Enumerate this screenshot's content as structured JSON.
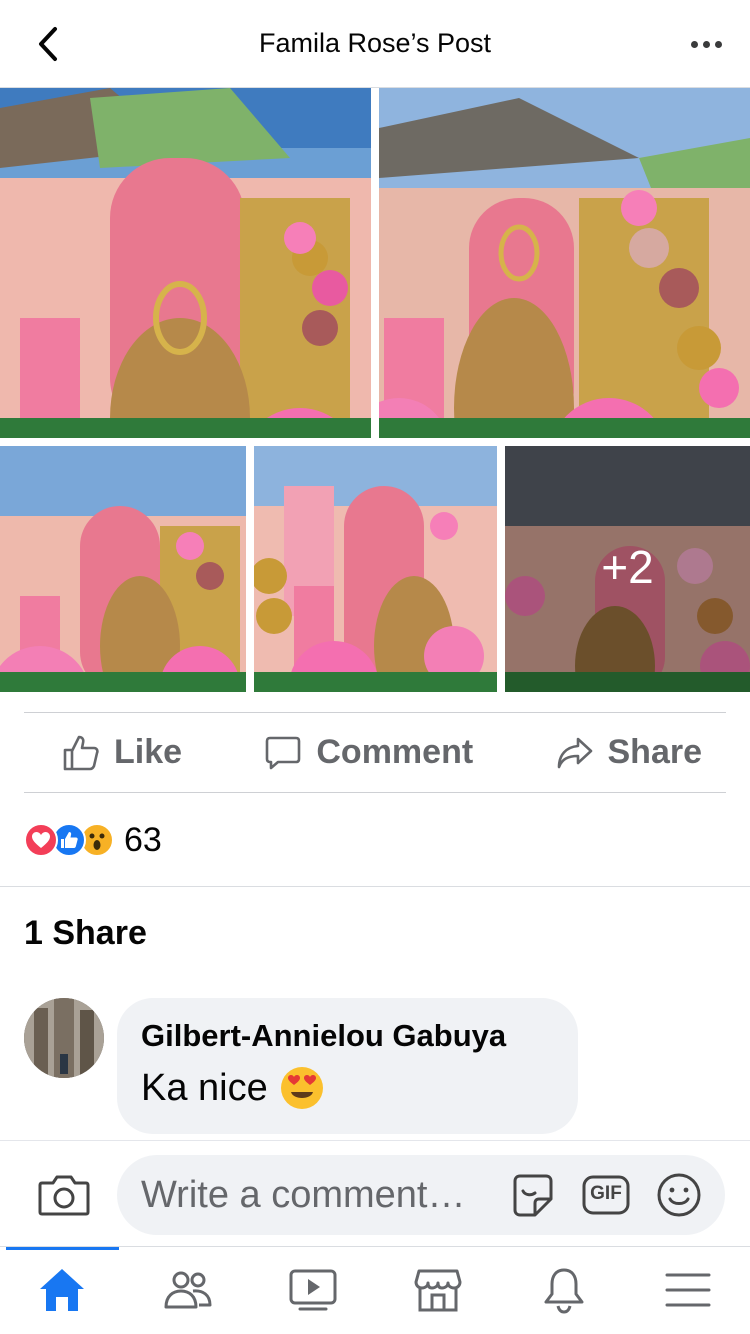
{
  "header": {
    "title": "Famila Rose’s Post",
    "back_icon": "chevron-left-icon",
    "more_icon": "more-horizontal-icon"
  },
  "photos": {
    "extra_count_label": "+2",
    "photo_count_shown": 5
  },
  "actions": {
    "like_label": "Like",
    "comment_label": "Comment",
    "share_label": "Share"
  },
  "reactions": {
    "types": [
      "love",
      "like",
      "wow"
    ],
    "count": "63"
  },
  "shares": {
    "label": "1 Share"
  },
  "comment": {
    "author": "Gilbert-Annielou Gabuya",
    "text": "Ka nice",
    "emoji": "😍"
  },
  "composer": {
    "placeholder": "Write a comment…",
    "gif_label": "GIF"
  },
  "tabbar": {
    "items": [
      "home-icon",
      "friends-icon",
      "watch-icon",
      "marketplace-icon",
      "notifications-icon",
      "menu-icon"
    ],
    "active": "home-icon"
  },
  "colors": {
    "accent": "#1877f2",
    "secondary_text": "#65676b",
    "bubble": "#f0f2f5",
    "love": "#f33e58",
    "like": "#1877f2",
    "wow": "#f7b125"
  }
}
